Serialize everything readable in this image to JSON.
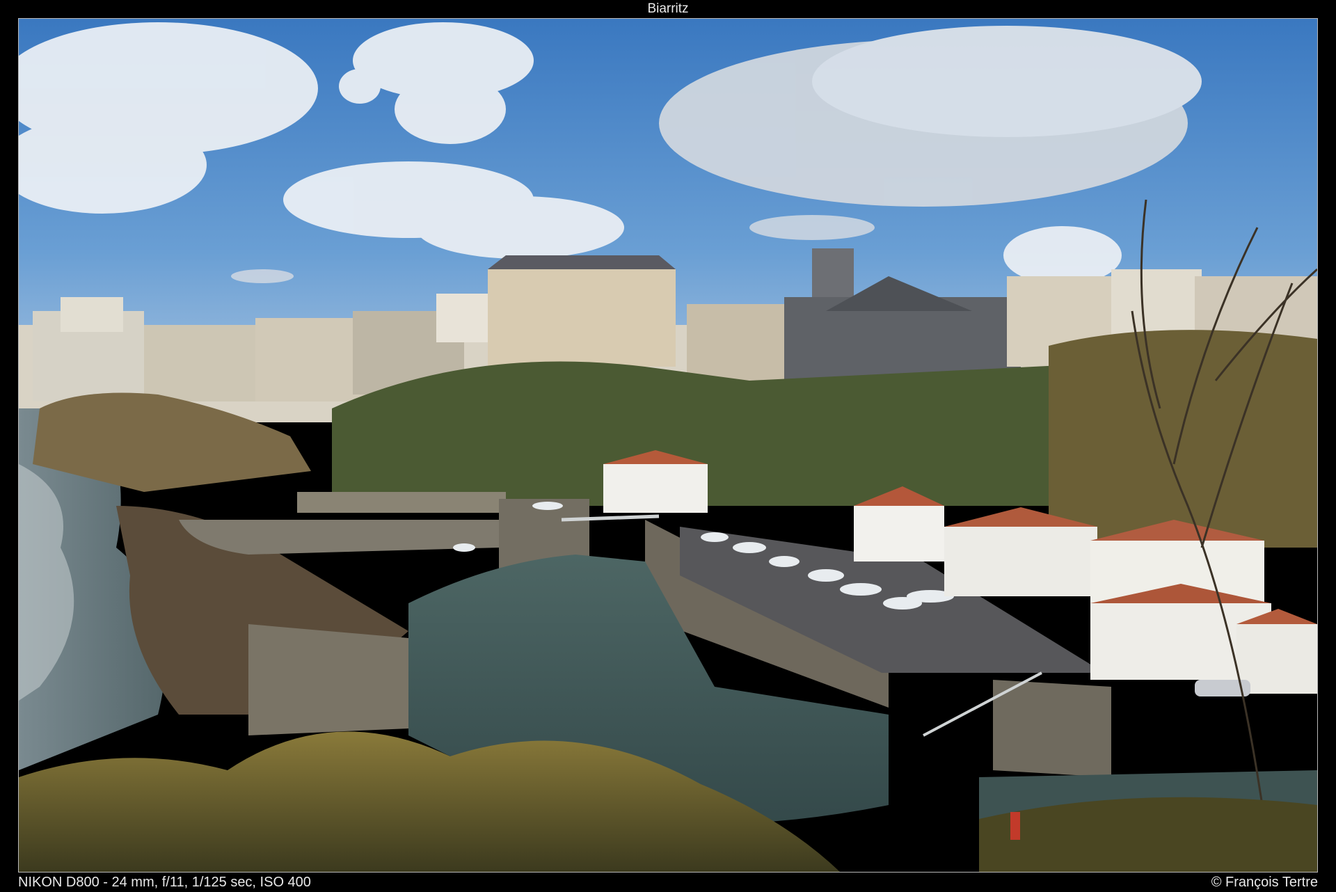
{
  "title": "Biarritz",
  "photo": {
    "scene": "harbour"
  },
  "footer": {
    "exif": "NIKON D800 - 24 mm, f/11, 1/125 sec, ISO 400",
    "credit": "© François Tertre"
  },
  "colors": {
    "background": "#000000",
    "text": "#e8e8e8",
    "sky": "#4a86c8",
    "water": "#3f5a56",
    "roof": "#b55a3a"
  }
}
